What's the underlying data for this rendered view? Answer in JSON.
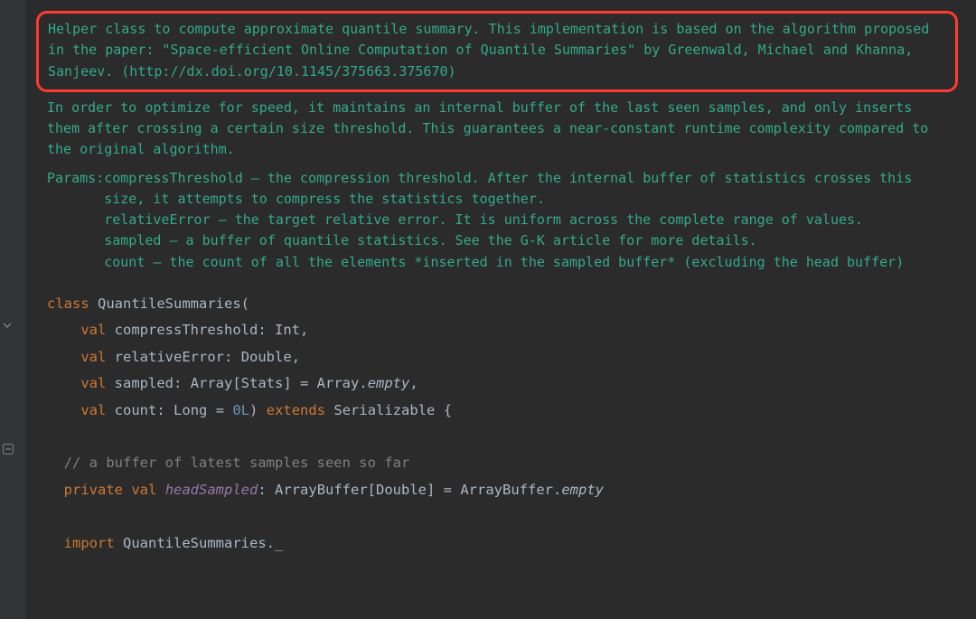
{
  "doc": {
    "highlight": "Helper class to compute approximate quantile summary. This implementation is based on the algorithm proposed in the paper: \"Space-efficient Online Computation of Quantile Summaries\" by Greenwald, Michael and Khanna, Sanjeev. (http://dx.doi.org/10.1145/375663.375670)",
    "p2": "In order to optimize for speed, it maintains an internal buffer of the last seen samples, and only inserts them after crossing a certain size threshold. This guarantees a near-constant runtime complexity compared to the original algorithm.",
    "params_label": "Params: ",
    "params": [
      "compressThreshold – the compression threshold. After the internal buffer of statistics crosses this size, it attempts to compress the statistics together.",
      "relativeError – the target relative error. It is uniform across the complete range of values.",
      "sampled – a buffer of quantile statistics. See the G-K article for more details.",
      "count – the count of all the elements *inserted in the sampled buffer* (excluding the head buffer)"
    ]
  },
  "code": {
    "kw_class": "class",
    "class_name": "QuantileSummaries",
    "paren_open": "(",
    "kw_val": "val",
    "p1_name": "compressThreshold",
    "colon": ":",
    "ty_int": "Int",
    "comma": ",",
    "p2_name": "relativeError",
    "ty_double": "Double",
    "p3_name": "sampled",
    "ty_array_stats": "Array[Stats]",
    "eq": " = ",
    "array": "Array",
    "dot": ".",
    "empty": "empty",
    "p4_name": "count",
    "ty_long": "Long",
    "zero_l": "0L",
    "paren_close": ")",
    "kw_extends": "extends",
    "serializable": "Serializable",
    "brace_open": "{",
    "comment_buf": "// a buffer of latest samples seen so far",
    "kw_private": "private",
    "headSampled": "headSampled",
    "ty_arraybuf_double": "ArrayBuffer[Double]",
    "arraybuffer": "ArrayBuffer",
    "kw_import": "import",
    "import_target": "QuantileSummaries._"
  }
}
